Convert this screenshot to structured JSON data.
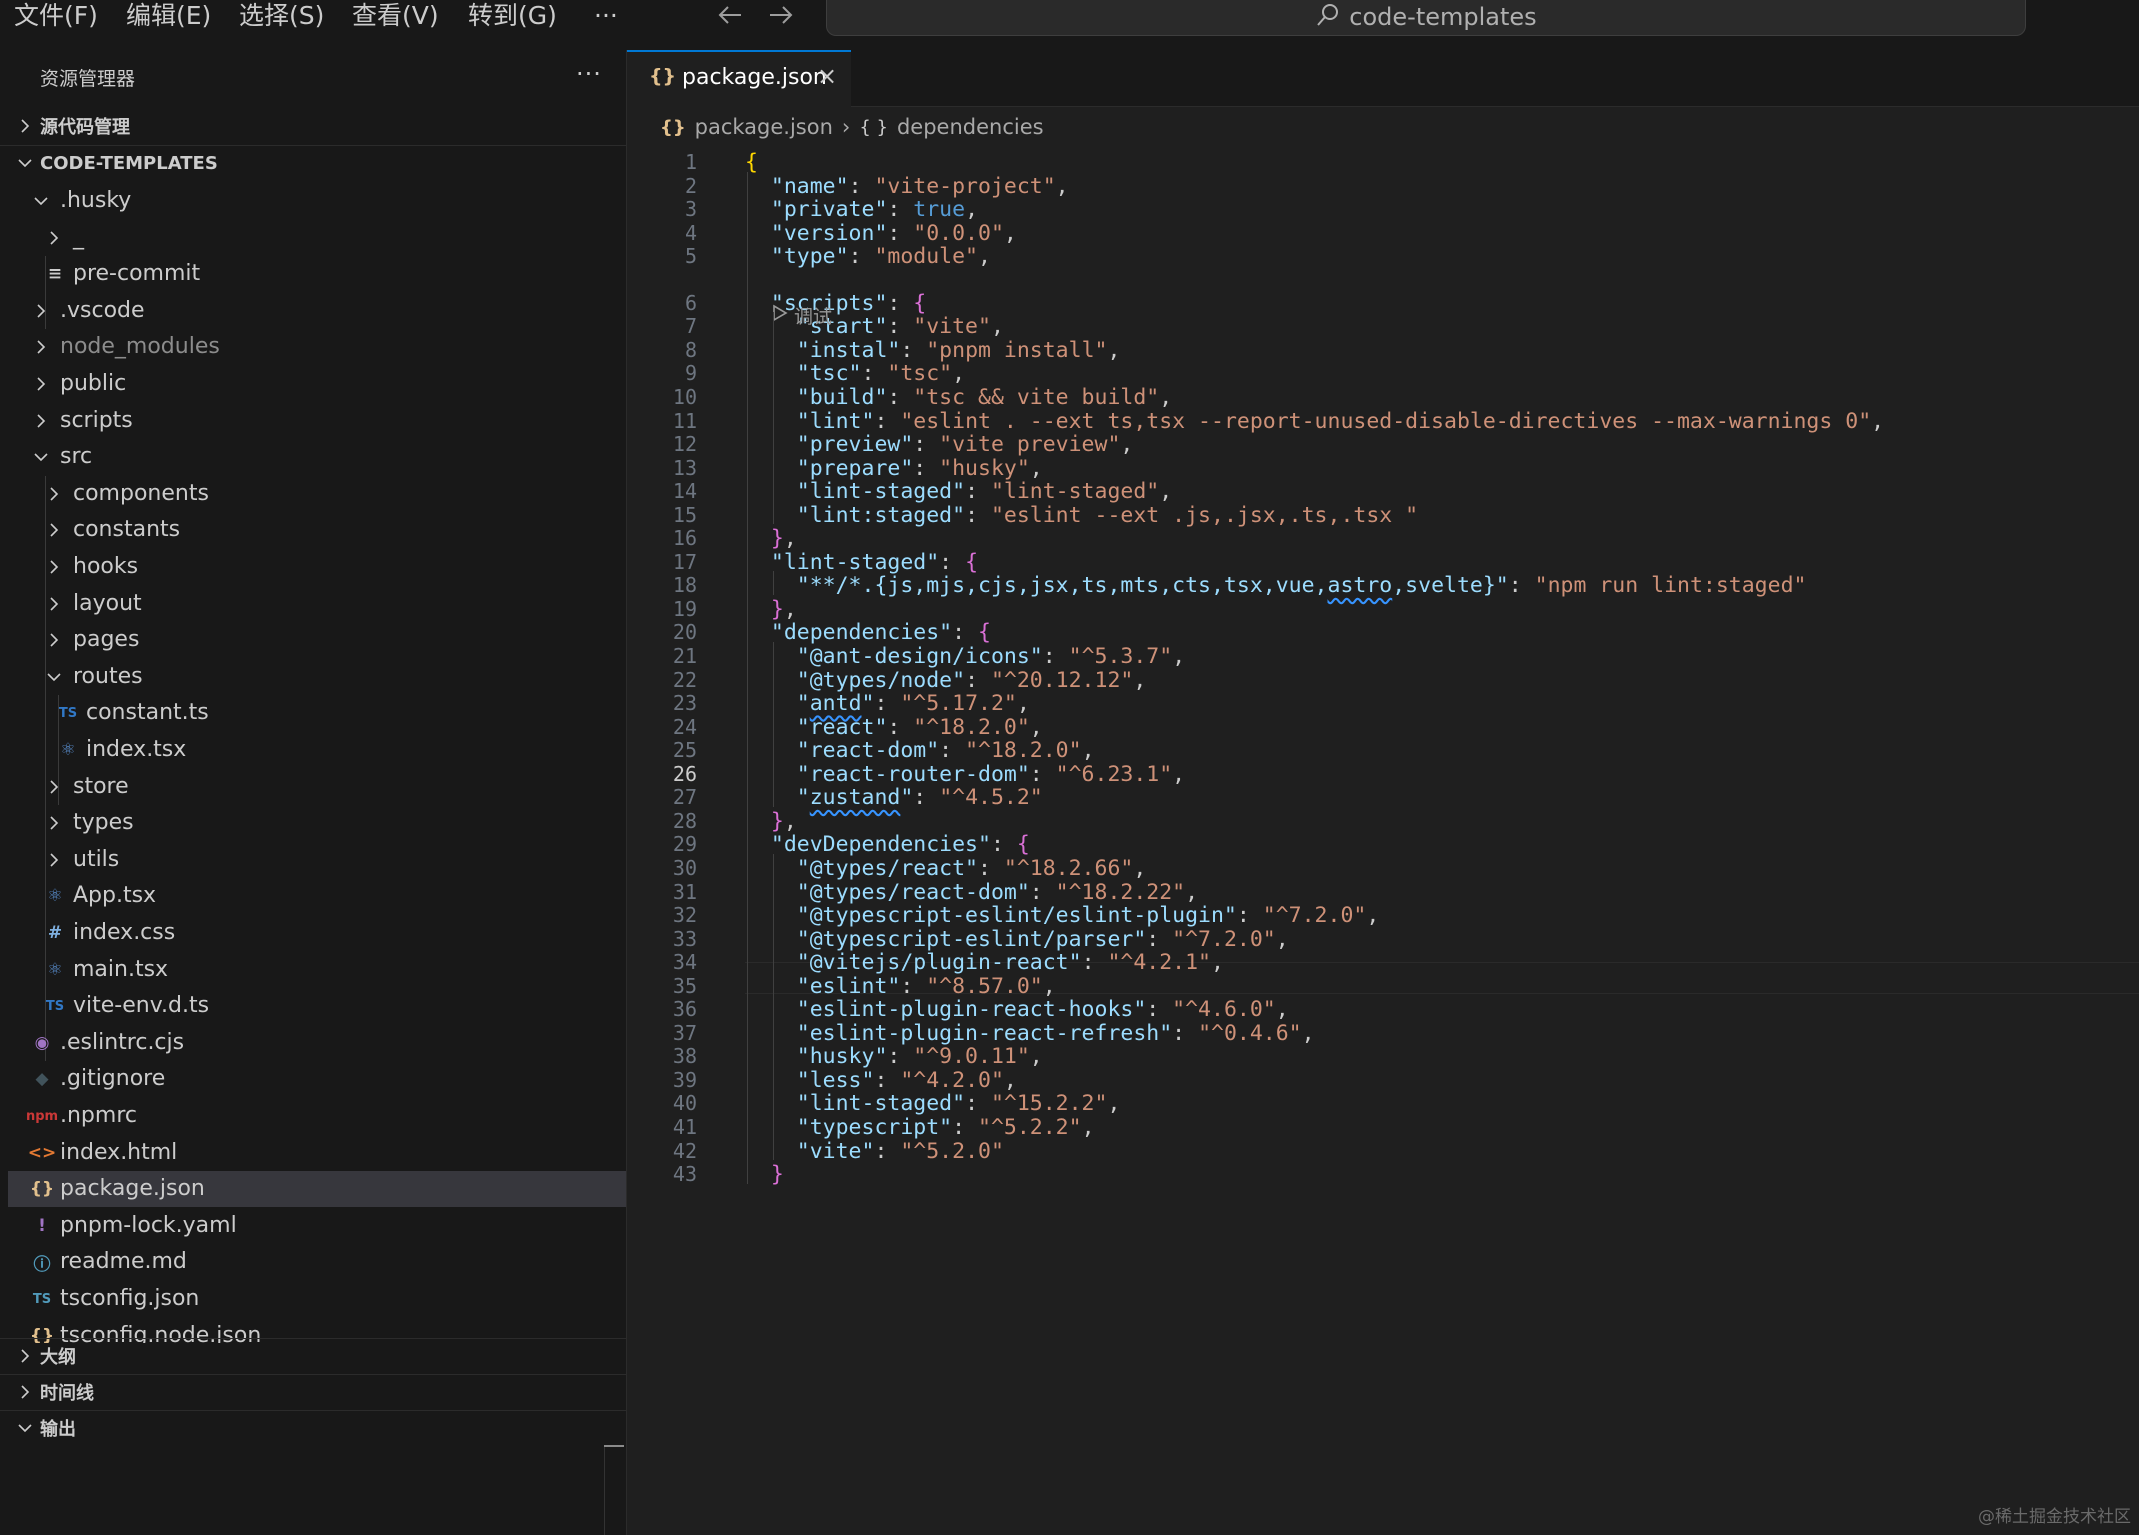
{
  "menu": {
    "file": "文件(F)",
    "edit": "编辑(E)",
    "selection": "选择(S)",
    "view": "查看(V)",
    "goto": "转到(G)",
    "more": "···"
  },
  "search": {
    "text": "code-templates"
  },
  "sidebar": {
    "title": "资源管理器",
    "more": "···",
    "source_control": "源代码管理",
    "workspace": "CODE-TEMPLATES",
    "outline": "大纲",
    "timeline": "时间线",
    "output": "输出"
  },
  "tree": [
    {
      "name": ".husky",
      "type": "folder-open",
      "depth": 1
    },
    {
      "name": "_",
      "type": "folder",
      "depth": 2
    },
    {
      "name": "pre-commit",
      "type": "file",
      "icon": "lines-icon",
      "depth": 2
    },
    {
      "name": ".vscode",
      "type": "folder",
      "depth": 1
    },
    {
      "name": "node_modules",
      "type": "folder",
      "depth": 1,
      "dim": true
    },
    {
      "name": "public",
      "type": "folder",
      "depth": 1
    },
    {
      "name": "scripts",
      "type": "folder",
      "depth": 1
    },
    {
      "name": "src",
      "type": "folder-open",
      "depth": 1
    },
    {
      "name": "components",
      "type": "folder",
      "depth": 2
    },
    {
      "name": "constants",
      "type": "folder",
      "depth": 2
    },
    {
      "name": "hooks",
      "type": "folder",
      "depth": 2
    },
    {
      "name": "layout",
      "type": "folder",
      "depth": 2
    },
    {
      "name": "pages",
      "type": "folder",
      "depth": 2
    },
    {
      "name": "routes",
      "type": "folder-open",
      "depth": 2
    },
    {
      "name": "constant.ts",
      "type": "file",
      "icon": "ts-icon",
      "depth": 3
    },
    {
      "name": "index.tsx",
      "type": "file",
      "icon": "react-icon",
      "depth": 3
    },
    {
      "name": "store",
      "type": "folder",
      "depth": 2
    },
    {
      "name": "types",
      "type": "folder",
      "depth": 2
    },
    {
      "name": "utils",
      "type": "folder",
      "depth": 2
    },
    {
      "name": "App.tsx",
      "type": "file",
      "icon": "react-icon",
      "depth": 2
    },
    {
      "name": "index.css",
      "type": "file",
      "icon": "css-hash-icon",
      "depth": 2
    },
    {
      "name": "main.tsx",
      "type": "file",
      "icon": "react-icon",
      "depth": 2
    },
    {
      "name": "vite-env.d.ts",
      "type": "file",
      "icon": "ts-icon",
      "depth": 2
    },
    {
      "name": ".eslintrc.cjs",
      "type": "file",
      "icon": "eslint-icon",
      "depth": 1
    },
    {
      "name": ".gitignore",
      "type": "file",
      "icon": "git-icon",
      "depth": 1
    },
    {
      "name": ".npmrc",
      "type": "file",
      "icon": "npm-icon",
      "depth": 1
    },
    {
      "name": "index.html",
      "type": "file",
      "icon": "html-icon",
      "depth": 1
    },
    {
      "name": "package.json",
      "type": "file",
      "icon": "json-icon",
      "depth": 1,
      "selected": true
    },
    {
      "name": "pnpm-lock.yaml",
      "type": "file",
      "icon": "yaml-icon",
      "depth": 1
    },
    {
      "name": "readme.md",
      "type": "file",
      "icon": "info-icon",
      "depth": 1
    },
    {
      "name": "tsconfig.json",
      "type": "file",
      "icon": "tsconfig-icon",
      "depth": 1
    },
    {
      "name": "tsconfig.node.json",
      "type": "file",
      "icon": "json-icon",
      "depth": 1
    }
  ],
  "icons": {
    "ts-icon": {
      "glyph": "TS",
      "color": "#3178c6"
    },
    "react-icon": {
      "glyph": "⚛",
      "color": "#5a8fd0"
    },
    "css-hash-icon": {
      "glyph": "#",
      "color": "#7fb0e0"
    },
    "eslint-icon": {
      "glyph": "◉",
      "color": "#a074c4"
    },
    "git-icon": {
      "glyph": "◆",
      "color": "#41535b"
    },
    "npm-icon": {
      "glyph": "npm",
      "color": "#cb3837"
    },
    "html-icon": {
      "glyph": "<>",
      "color": "#e37933"
    },
    "json-icon": {
      "glyph": "{}",
      "color": "#e2c08d"
    },
    "yaml-icon": {
      "glyph": "!",
      "color": "#a074c4"
    },
    "info-icon": {
      "glyph": "ⓘ",
      "color": "#519aba"
    },
    "tsconfig-icon": {
      "glyph": "TS",
      "color": "#519aba"
    },
    "lines-icon": {
      "glyph": "≡",
      "color": "#cccccc"
    }
  },
  "tab": {
    "label": "package.json",
    "close": "×",
    "icon": "{}"
  },
  "breadcrumb": {
    "file": "package.json",
    "sep": "›",
    "symbol": "dependencies",
    "file_icon": "{}",
    "symbol_icon": "{ }"
  },
  "codelens": {
    "label": "调试"
  },
  "editor": {
    "current_line": 26,
    "lines": [
      [
        [
          "br1",
          "{"
        ]
      ],
      [
        [
          "t",
          "  "
        ],
        [
          "k",
          "\"name\""
        ],
        [
          "t",
          ": "
        ],
        [
          "s",
          "\"vite-project\""
        ],
        [
          "t",
          ","
        ]
      ],
      [
        [
          "t",
          "  "
        ],
        [
          "k",
          "\"private\""
        ],
        [
          "t",
          ": "
        ],
        [
          "b",
          "true"
        ],
        [
          "t",
          ","
        ]
      ],
      [
        [
          "t",
          "  "
        ],
        [
          "k",
          "\"version\""
        ],
        [
          "t",
          ": "
        ],
        [
          "s",
          "\"0.0.0\""
        ],
        [
          "t",
          ","
        ]
      ],
      [
        [
          "t",
          "  "
        ],
        [
          "k",
          "\"type\""
        ],
        [
          "t",
          ": "
        ],
        [
          "s",
          "\"module\""
        ],
        [
          "t",
          ","
        ]
      ],
      [
        [
          "t",
          "  "
        ],
        [
          "k",
          "\"scripts\""
        ],
        [
          "t",
          ": "
        ],
        [
          "br2",
          "{"
        ]
      ],
      [
        [
          "t",
          "    "
        ],
        [
          "k",
          "\"start\""
        ],
        [
          "t",
          ": "
        ],
        [
          "s",
          "\"vite\""
        ],
        [
          "t",
          ","
        ]
      ],
      [
        [
          "t",
          "    "
        ],
        [
          "k",
          "\"instal\""
        ],
        [
          "t",
          ": "
        ],
        [
          "s",
          "\"pnpm install\""
        ],
        [
          "t",
          ","
        ]
      ],
      [
        [
          "t",
          "    "
        ],
        [
          "k",
          "\"tsc\""
        ],
        [
          "t",
          ": "
        ],
        [
          "s",
          "\"tsc\""
        ],
        [
          "t",
          ","
        ]
      ],
      [
        [
          "t",
          "    "
        ],
        [
          "k",
          "\"build\""
        ],
        [
          "t",
          ": "
        ],
        [
          "s",
          "\"tsc && vite build\""
        ],
        [
          "t",
          ","
        ]
      ],
      [
        [
          "t",
          "    "
        ],
        [
          "k",
          "\"lint\""
        ],
        [
          "t",
          ": "
        ],
        [
          "s",
          "\"eslint . --ext ts,tsx --report-unused-disable-directives --max-warnings 0\""
        ],
        [
          "t",
          ","
        ]
      ],
      [
        [
          "t",
          "    "
        ],
        [
          "k",
          "\"preview\""
        ],
        [
          "t",
          ": "
        ],
        [
          "s",
          "\"vite preview\""
        ],
        [
          "t",
          ","
        ]
      ],
      [
        [
          "t",
          "    "
        ],
        [
          "k",
          "\"prepare\""
        ],
        [
          "t",
          ": "
        ],
        [
          "s",
          "\"husky\""
        ],
        [
          "t",
          ","
        ]
      ],
      [
        [
          "t",
          "    "
        ],
        [
          "k",
          "\"lint-staged\""
        ],
        [
          "t",
          ": "
        ],
        [
          "s",
          "\"lint-staged\""
        ],
        [
          "t",
          ","
        ]
      ],
      [
        [
          "t",
          "    "
        ],
        [
          "k",
          "\"lint:staged\""
        ],
        [
          "t",
          ": "
        ],
        [
          "s",
          "\"eslint --ext .js,.jsx,.ts,.tsx \""
        ]
      ],
      [
        [
          "t",
          "  "
        ],
        [
          "br2",
          "}"
        ],
        [
          "t",
          ","
        ]
      ],
      [
        [
          "t",
          "  "
        ],
        [
          "k",
          "\"lint-staged\""
        ],
        [
          "t",
          ": "
        ],
        [
          "br2",
          "{"
        ]
      ],
      [
        [
          "t",
          "    "
        ],
        [
          "k",
          "\"**/*.{js,mjs,cjs,jsx,ts,mts,cts,tsx,vue,"
        ],
        [
          "ksq",
          "astro"
        ],
        [
          "k",
          ",svelte}\""
        ],
        [
          "t",
          ": "
        ],
        [
          "s",
          "\"npm run lint:staged\""
        ]
      ],
      [
        [
          "t",
          "  "
        ],
        [
          "br2",
          "}"
        ],
        [
          "t",
          ","
        ]
      ],
      [
        [
          "t",
          "  "
        ],
        [
          "k",
          "\"dependencies\""
        ],
        [
          "t",
          ": "
        ],
        [
          "br2",
          "{"
        ]
      ],
      [
        [
          "t",
          "    "
        ],
        [
          "k",
          "\"@ant-design/icons\""
        ],
        [
          "t",
          ": "
        ],
        [
          "s",
          "\"^5.3.7\""
        ],
        [
          "t",
          ","
        ]
      ],
      [
        [
          "t",
          "    "
        ],
        [
          "k",
          "\"@types/node\""
        ],
        [
          "t",
          ": "
        ],
        [
          "s",
          "\"^20.12.12\""
        ],
        [
          "t",
          ","
        ]
      ],
      [
        [
          "t",
          "    "
        ],
        [
          "k",
          "\""
        ],
        [
          "ksq",
          "antd"
        ],
        [
          "k",
          "\""
        ],
        [
          "t",
          ": "
        ],
        [
          "s",
          "\"^5.17.2\""
        ],
        [
          "t",
          ","
        ]
      ],
      [
        [
          "t",
          "    "
        ],
        [
          "k",
          "\"react\""
        ],
        [
          "t",
          ": "
        ],
        [
          "s",
          "\"^18.2.0\""
        ],
        [
          "t",
          ","
        ]
      ],
      [
        [
          "t",
          "    "
        ],
        [
          "k",
          "\"react-dom\""
        ],
        [
          "t",
          ": "
        ],
        [
          "s",
          "\"^18.2.0\""
        ],
        [
          "t",
          ","
        ]
      ],
      [
        [
          "t",
          "    "
        ],
        [
          "k",
          "\"react-router-dom\""
        ],
        [
          "t",
          ": "
        ],
        [
          "s",
          "\"^6.23.1\""
        ],
        [
          "t",
          ","
        ]
      ],
      [
        [
          "t",
          "    "
        ],
        [
          "k",
          "\""
        ],
        [
          "ksq",
          "zustand"
        ],
        [
          "k",
          "\""
        ],
        [
          "t",
          ": "
        ],
        [
          "s",
          "\"^4.5.2\""
        ]
      ],
      [
        [
          "t",
          "  "
        ],
        [
          "br2",
          "}"
        ],
        [
          "t",
          ","
        ]
      ],
      [
        [
          "t",
          "  "
        ],
        [
          "k",
          "\"devDependencies\""
        ],
        [
          "t",
          ": "
        ],
        [
          "br2",
          "{"
        ]
      ],
      [
        [
          "t",
          "    "
        ],
        [
          "k",
          "\"@types/react\""
        ],
        [
          "t",
          ": "
        ],
        [
          "s",
          "\"^18.2.66\""
        ],
        [
          "t",
          ","
        ]
      ],
      [
        [
          "t",
          "    "
        ],
        [
          "k",
          "\"@types/react-dom\""
        ],
        [
          "t",
          ": "
        ],
        [
          "s",
          "\"^18.2.22\""
        ],
        [
          "t",
          ","
        ]
      ],
      [
        [
          "t",
          "    "
        ],
        [
          "k",
          "\"@typescript-eslint/eslint-plugin\""
        ],
        [
          "t",
          ": "
        ],
        [
          "s",
          "\"^7.2.0\""
        ],
        [
          "t",
          ","
        ]
      ],
      [
        [
          "t",
          "    "
        ],
        [
          "k",
          "\"@typescript-eslint/parser\""
        ],
        [
          "t",
          ": "
        ],
        [
          "s",
          "\"^7.2.0\""
        ],
        [
          "t",
          ","
        ]
      ],
      [
        [
          "t",
          "    "
        ],
        [
          "k",
          "\"@vitejs/plugin-react\""
        ],
        [
          "t",
          ": "
        ],
        [
          "s",
          "\"^4.2.1\""
        ],
        [
          "t",
          ","
        ]
      ],
      [
        [
          "t",
          "    "
        ],
        [
          "k",
          "\"eslint\""
        ],
        [
          "t",
          ": "
        ],
        [
          "s",
          "\"^8.57.0\""
        ],
        [
          "t",
          ","
        ]
      ],
      [
        [
          "t",
          "    "
        ],
        [
          "k",
          "\"eslint-plugin-react-hooks\""
        ],
        [
          "t",
          ": "
        ],
        [
          "s",
          "\"^4.6.0\""
        ],
        [
          "t",
          ","
        ]
      ],
      [
        [
          "t",
          "    "
        ],
        [
          "k",
          "\"eslint-plugin-react-refresh\""
        ],
        [
          "t",
          ": "
        ],
        [
          "s",
          "\"^0.4.6\""
        ],
        [
          "t",
          ","
        ]
      ],
      [
        [
          "t",
          "    "
        ],
        [
          "k",
          "\"husky\""
        ],
        [
          "t",
          ": "
        ],
        [
          "s",
          "\"^9.0.11\""
        ],
        [
          "t",
          ","
        ]
      ],
      [
        [
          "t",
          "    "
        ],
        [
          "k",
          "\"less\""
        ],
        [
          "t",
          ": "
        ],
        [
          "s",
          "\"^4.2.0\""
        ],
        [
          "t",
          ","
        ]
      ],
      [
        [
          "t",
          "    "
        ],
        [
          "k",
          "\"lint-staged\""
        ],
        [
          "t",
          ": "
        ],
        [
          "s",
          "\"^15.2.2\""
        ],
        [
          "t",
          ","
        ]
      ],
      [
        [
          "t",
          "    "
        ],
        [
          "k",
          "\"typescript\""
        ],
        [
          "t",
          ": "
        ],
        [
          "s",
          "\"^5.2.2\""
        ],
        [
          "t",
          ","
        ]
      ],
      [
        [
          "t",
          "    "
        ],
        [
          "k",
          "\"vite\""
        ],
        [
          "t",
          ": "
        ],
        [
          "s",
          "\"^5.2.0\""
        ]
      ],
      [
        [
          "t",
          "  "
        ],
        [
          "br2",
          "}"
        ]
      ]
    ]
  },
  "watermark": "@稀土掘金技术社区"
}
